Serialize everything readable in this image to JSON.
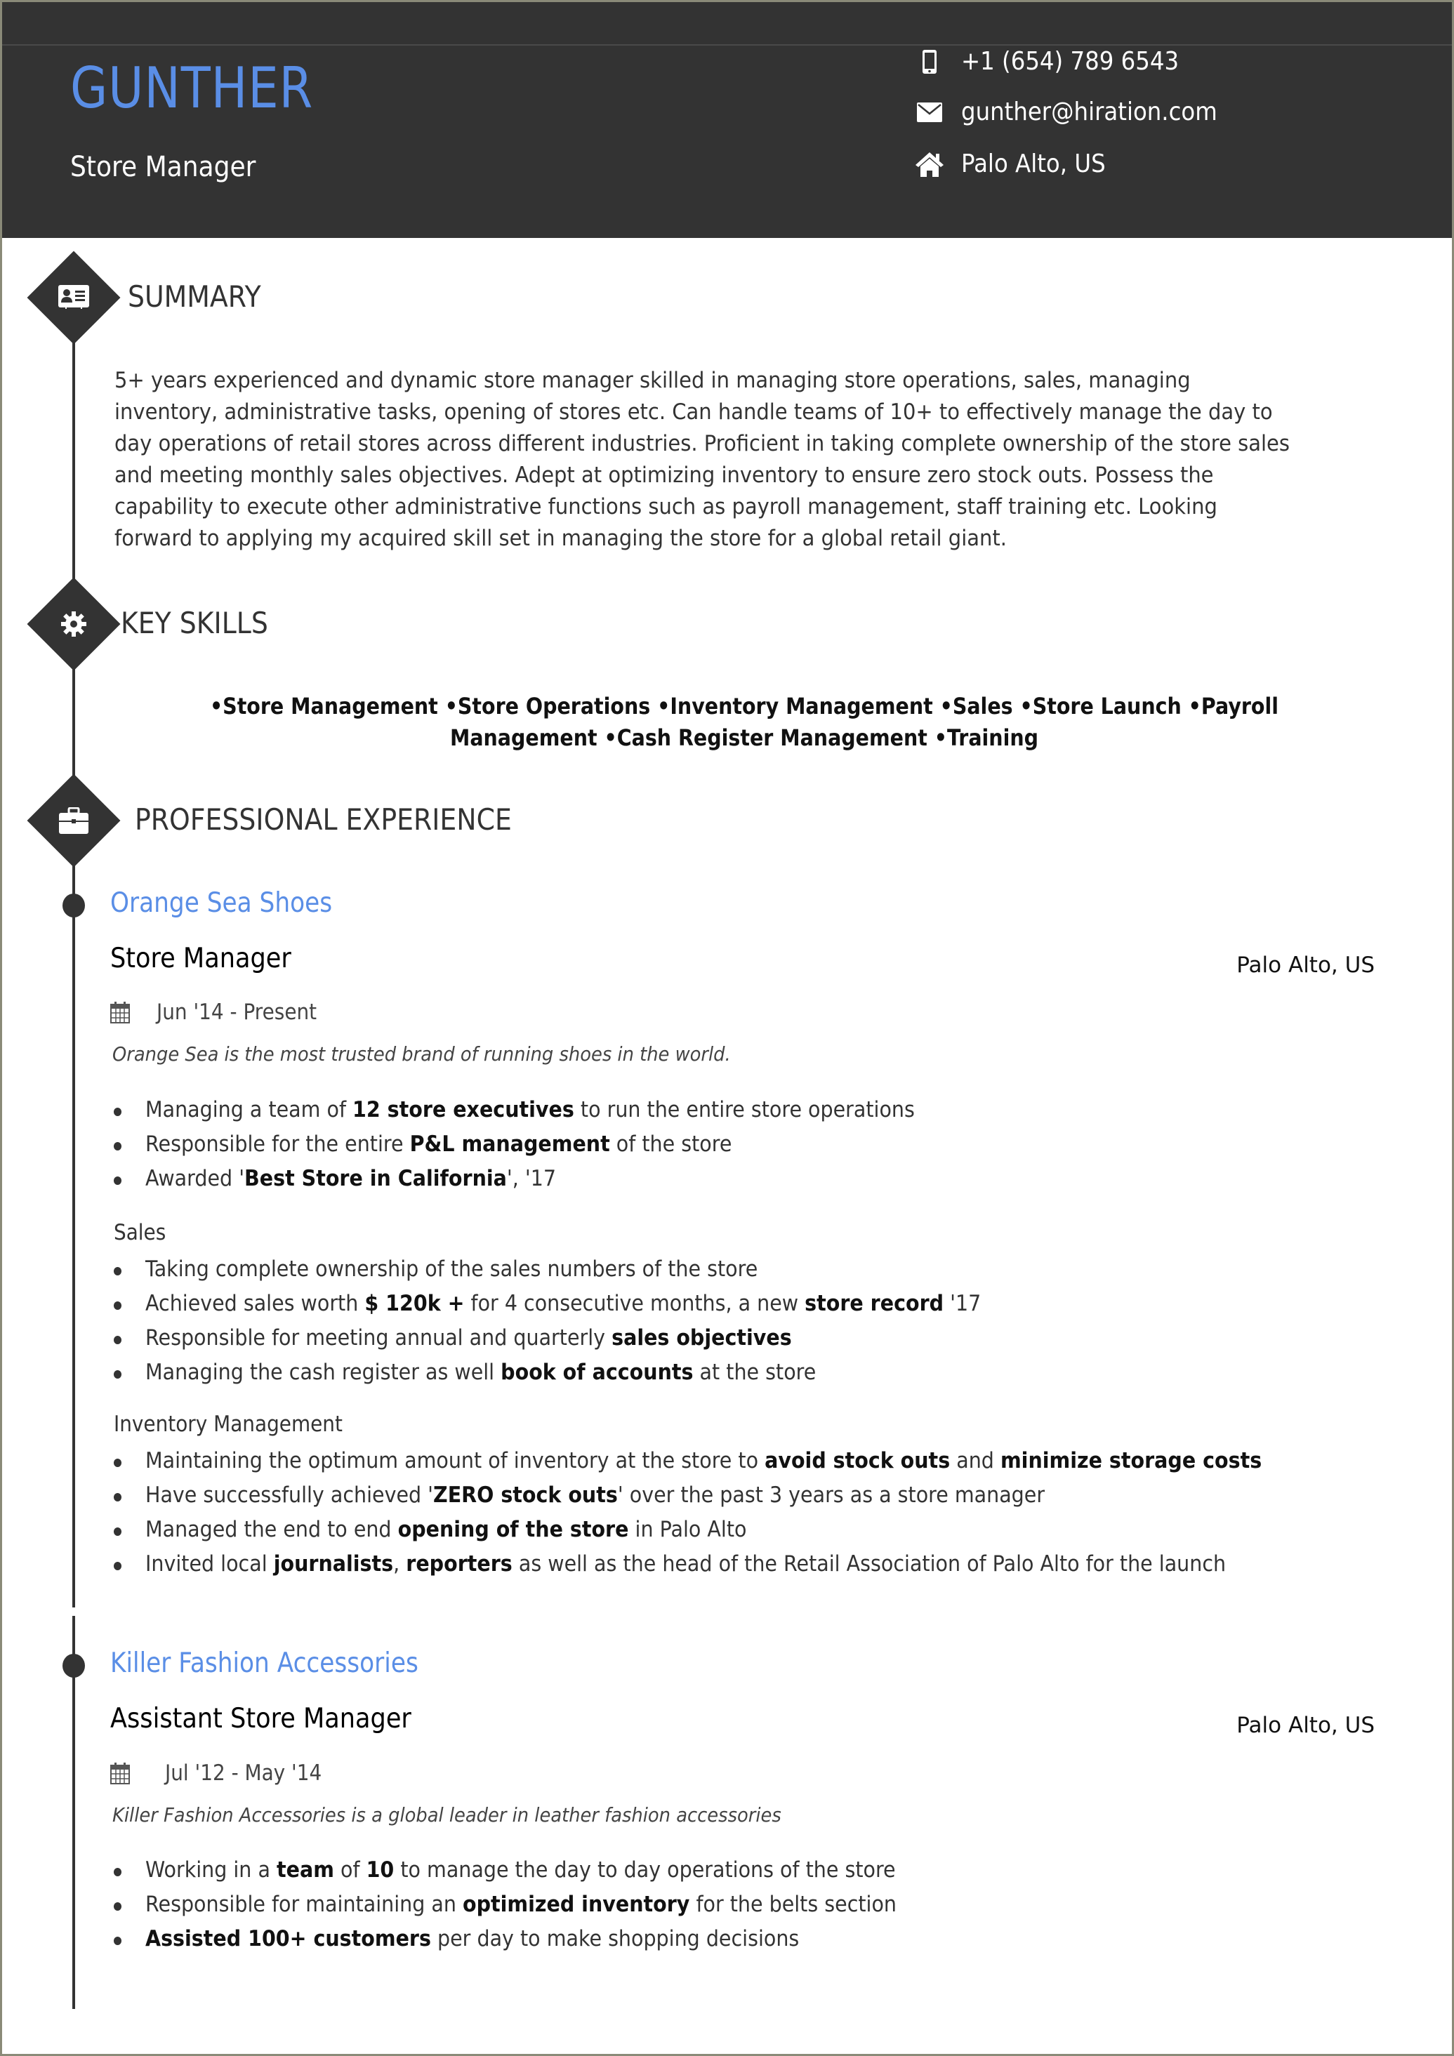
{
  "header": {
    "name": "GUNTHER",
    "headline": "Store Manager",
    "contact": {
      "phone": "+1 (654) 789 6543",
      "email": "gunther@hiration.com",
      "location": "Palo Alto, US"
    },
    "colors": {
      "background": "#333333",
      "name": "#5a8ee6",
      "text": "#ffffff"
    }
  },
  "summary": {
    "title": "SUMMARY",
    "icon": "id-card-icon",
    "text": "5+ years experienced and dynamic store manager skilled in managing store operations, sales, managing inventory, administrative tasks, opening of stores etc. Can handle teams of 10+ to effectively manage the day to day operations of retail stores across different industries. Proficient in taking complete ownership of the store sales and meeting monthly sales objectives. Adept at optimizing inventory to ensure zero stock outs. Possess the capability to execute other administrative functions such as payroll management, staff training etc. Looking forward to applying my acquired skill set in managing the store for a global retail giant."
  },
  "key_skills": {
    "title": "KEY SKILLS",
    "icon": "gear-icon",
    "items": [
      "Store Management",
      "Store Operations",
      "Inventory Management",
      "Sales",
      "Store Launch",
      "Payroll Management",
      "Cash Register Management",
      "Training"
    ]
  },
  "experience": {
    "title": "PROFESSIONAL EXPERIENCE",
    "icon": "briefcase-icon",
    "jobs": [
      {
        "company": "Orange Sea Shoes",
        "role": "Store Manager",
        "location": "Palo Alto, US",
        "dates": "Jun '14 -  Present",
        "description": "Orange Sea is the most trusted brand of running shoes in the world.",
        "groups": [
          {
            "heading": "",
            "bullets": [
              [
                {
                  "t": "Managing a team of "
                },
                {
                  "b": "12 store executives"
                },
                {
                  "t": " to run the entire store operations"
                }
              ],
              [
                {
                  "t": "Responsible for the entire "
                },
                {
                  "b": "P&L management"
                },
                {
                  "t": " of the store"
                }
              ],
              [
                {
                  "t": "Awarded '"
                },
                {
                  "b": "Best Store in California"
                },
                {
                  "t": "', '17"
                }
              ]
            ]
          },
          {
            "heading": "Sales",
            "bullets": [
              [
                {
                  "t": "Taking complete ownership of the sales numbers of the store"
                }
              ],
              [
                {
                  "t": "Achieved sales worth "
                },
                {
                  "b": "$ 120k +"
                },
                {
                  "t": " for 4 consecutive months, a new "
                },
                {
                  "b": "store record"
                },
                {
                  "t": " '17"
                }
              ],
              [
                {
                  "t": "Responsible for meeting annual and quarterly "
                },
                {
                  "b": "sales objectives"
                }
              ],
              [
                {
                  "t": "Managing the cash register as well "
                },
                {
                  "b": "book of accounts"
                },
                {
                  "t": " at the store"
                }
              ]
            ]
          },
          {
            "heading": "Inventory Management",
            "bullets": [
              [
                {
                  "t": "Maintaining the optimum amount of inventory at the store to "
                },
                {
                  "b": "avoid stock outs"
                },
                {
                  "t": " and "
                },
                {
                  "b": "minimize storage costs"
                }
              ],
              [
                {
                  "t": "Have successfully achieved '"
                },
                {
                  "b": "ZERO stock outs"
                },
                {
                  "t": "' over the past 3 years as a store manager"
                }
              ],
              [
                {
                  "t": "Managed the end to end "
                },
                {
                  "b": "opening of the store"
                },
                {
                  "t": " in Palo Alto"
                }
              ],
              [
                {
                  "t": "Invited local "
                },
                {
                  "b": "journalists"
                },
                {
                  "t": ", "
                },
                {
                  "b": "reporters"
                },
                {
                  "t": " as well as the head of the Retail Association of Palo Alto for the launch"
                }
              ]
            ]
          }
        ]
      },
      {
        "company": "Killer Fashion Accessories",
        "role": "Assistant Store Manager",
        "location": "Palo Alto, US",
        "dates": "Jul '12 -  May '14",
        "description": "Killer Fashion Accessories is a global leader in leather fashion accessories",
        "groups": [
          {
            "heading": "",
            "bullets": [
              [
                {
                  "t": "Working in a "
                },
                {
                  "b": "team"
                },
                {
                  "t": " of "
                },
                {
                  "b": "10"
                },
                {
                  "t": " to manage the day to day operations of the store"
                }
              ],
              [
                {
                  "t": "Responsible for maintaining an "
                },
                {
                  "b": "optimized inventory"
                },
                {
                  "t": " for the belts section"
                }
              ],
              [
                {
                  "b": "Assisted 100+ customers"
                },
                {
                  "t": " per day to make shopping decisions"
                }
              ]
            ]
          }
        ]
      }
    ]
  }
}
